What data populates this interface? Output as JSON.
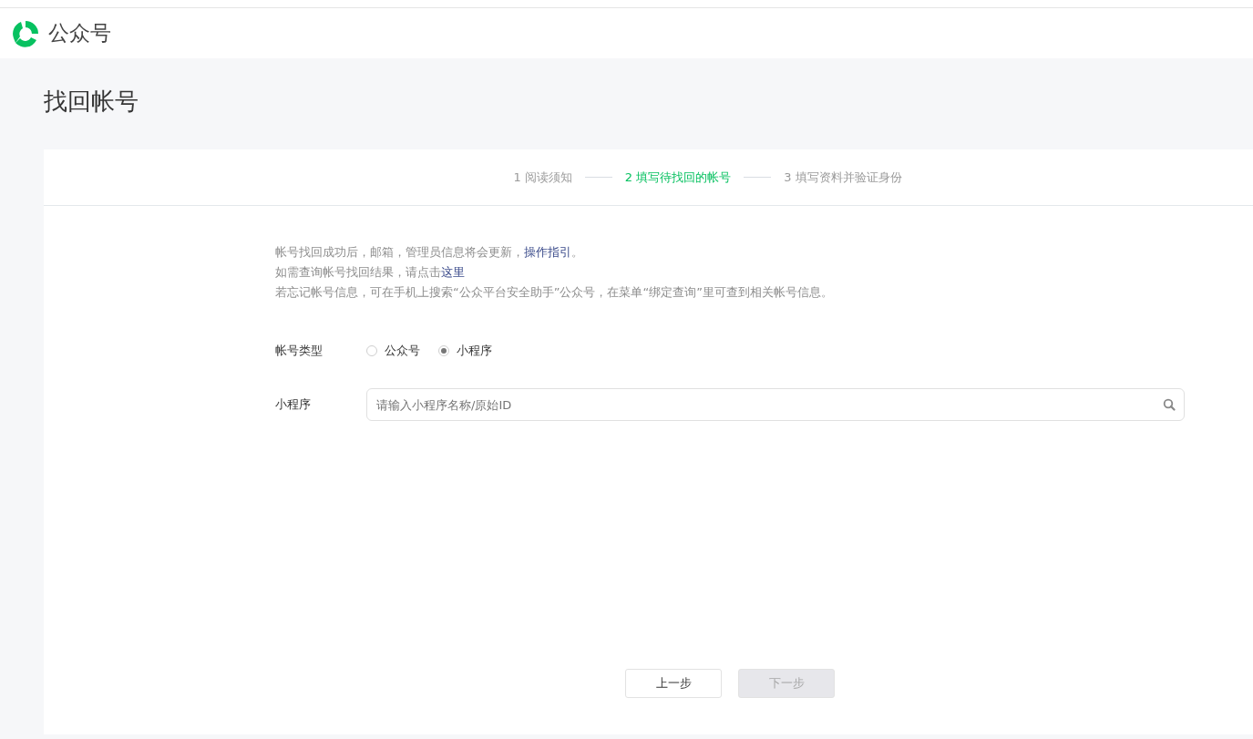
{
  "header": {
    "brand": "公众号"
  },
  "page": {
    "title": "找回帐号"
  },
  "steps": [
    {
      "label": "1 阅读须知",
      "selected": false
    },
    {
      "label": "2 填写待找回的帐号",
      "selected": true
    },
    {
      "label": "3 填写资料并验证身份",
      "selected": false
    }
  ],
  "notices": [
    {
      "text": "帐号找回成功后，邮箱，管理员信息将会更新，",
      "link": "操作指引",
      "after": "。"
    },
    {
      "text": "如需查询帐号找回结果，请点击",
      "link": "这里"
    },
    {
      "text": "若忘记帐号信息，可在手机上搜索“公众平台安全助手”公众号，在菜单“绑定查询”里可查到相关帐号信息。"
    }
  ],
  "account_type": {
    "label": "帐号类型",
    "options": [
      {
        "label": "公众号",
        "selected": false
      },
      {
        "label": "小程序",
        "selected": true
      }
    ]
  },
  "search": {
    "label": "小程序",
    "placeholder": "请输入小程序名称/原始ID"
  },
  "buttons": [
    {
      "label": "上一步",
      "disabled": false
    },
    {
      "label": "下一步",
      "disabled": true
    }
  ]
}
